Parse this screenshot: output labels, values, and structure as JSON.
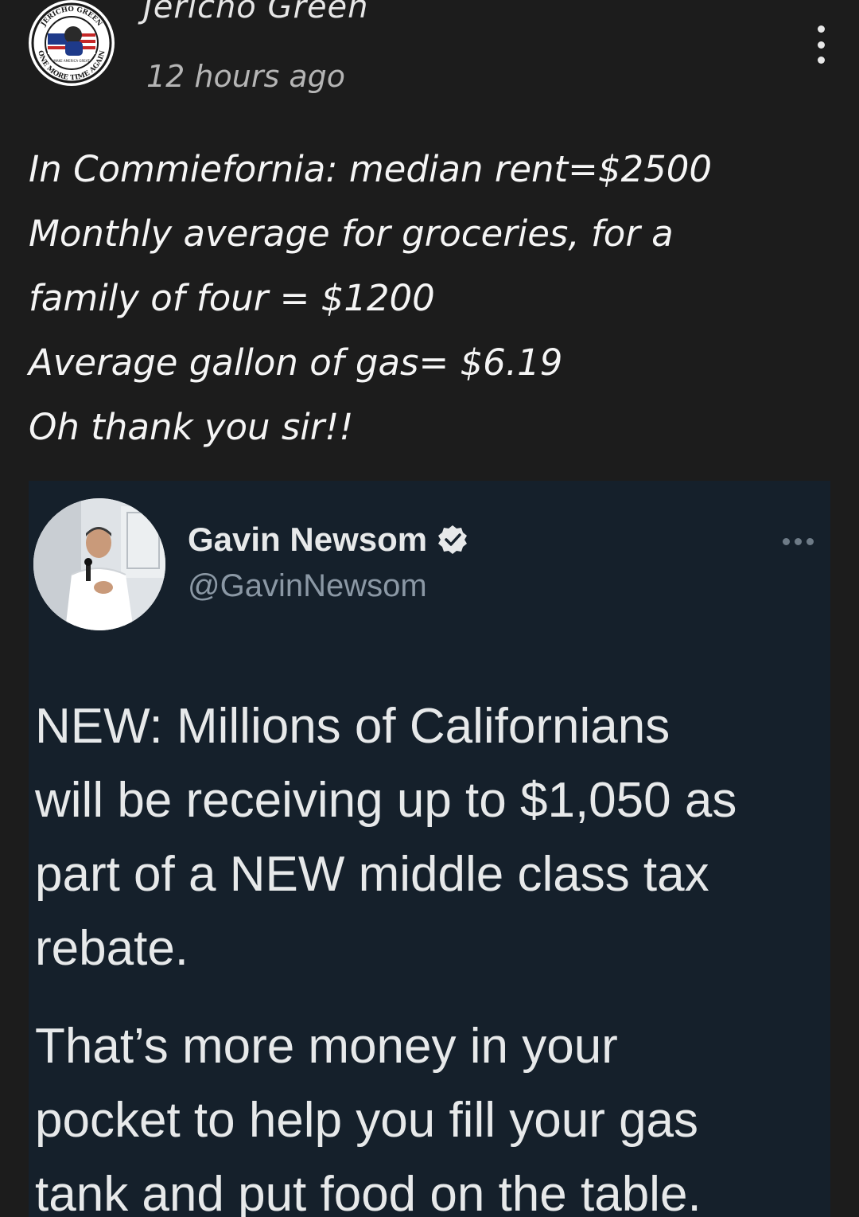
{
  "post": {
    "author_name": "Jericho Green",
    "timestamp": "12 hours ago",
    "more_icon": "vertical-ellipsis",
    "avatar_text": {
      "top": "JERICHO GREEN",
      "bottom": "ONE MORE TIME AGAIN",
      "middle": "MAKE AMERICA GREAT"
    },
    "text_lines": [
      "In Commiefornia: median rent=$2500",
      "Monthly average for groceries, for a",
      "family of four = $1200",
      "Average gallon of gas= $6.19",
      "Oh thank you sir!!"
    ]
  },
  "tweet": {
    "name": "Gavin Newsom",
    "handle": "@GavinNewsom",
    "verified_icon": "verified-badge",
    "more_icon": "horizontal-ellipsis",
    "paragraph_1": [
      "NEW: Millions of Californians",
      "will be receiving up to $1,050 as",
      "part of a NEW middle class tax",
      "rebate."
    ],
    "paragraph_2": [
      "That’s more money in your",
      "pocket to help you fill your gas",
      "tank and put food on the table."
    ]
  },
  "colors": {
    "page_background": "#1c1c1c",
    "tweet_background": "#15202b",
    "tweet_text": "#e7e9ea",
    "tweet_handle": "#8b98a5"
  }
}
